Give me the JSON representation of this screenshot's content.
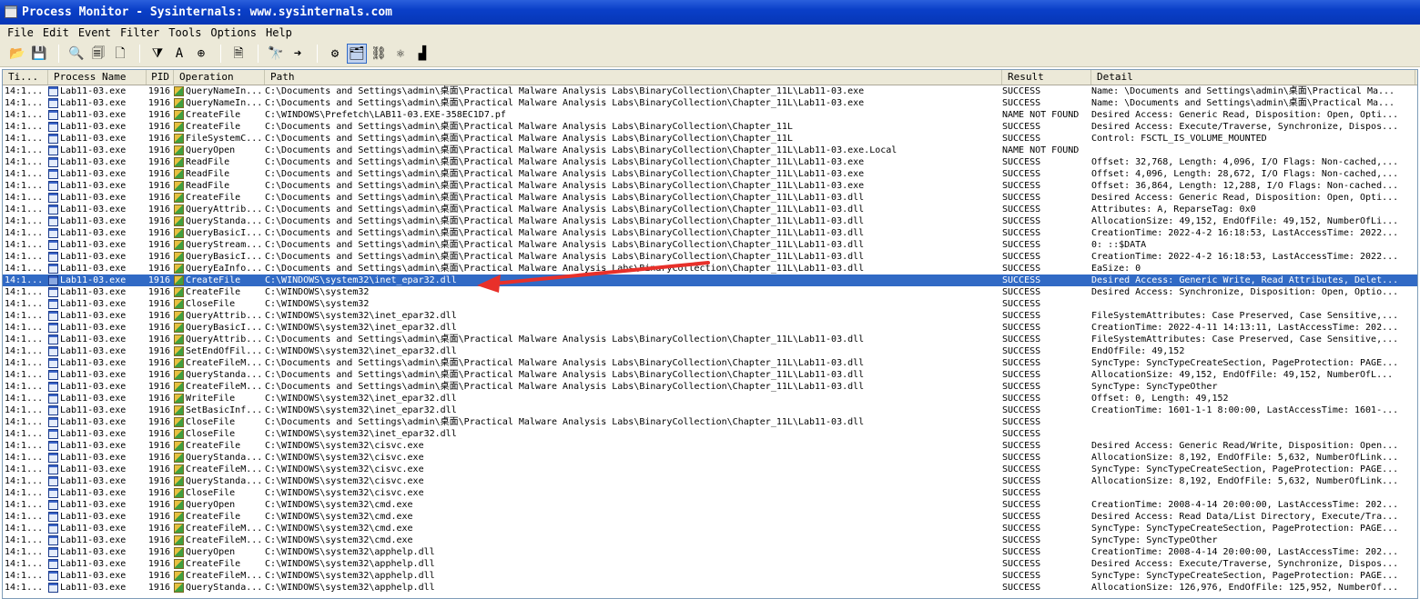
{
  "window": {
    "title": "Process Monitor - Sysinternals: www.sysinternals.com"
  },
  "menu": [
    "File",
    "Edit",
    "Event",
    "Filter",
    "Tools",
    "Options",
    "Help"
  ],
  "toolbar": {
    "buttons": [
      {
        "name": "open-icon",
        "glyph": "📂"
      },
      {
        "name": "save-icon",
        "glyph": "💾"
      },
      {
        "sep": true
      },
      {
        "name": "capture-icon",
        "glyph": "🔍"
      },
      {
        "name": "autoscroll-icon",
        "glyph": "🗐"
      },
      {
        "name": "clear-icon",
        "glyph": "🗋"
      },
      {
        "sep": true
      },
      {
        "name": "filter-icon",
        "glyph": "⧩"
      },
      {
        "name": "highlight-icon",
        "glyph": "A"
      },
      {
        "name": "include-process-icon",
        "glyph": "⊕"
      },
      {
        "sep": true
      },
      {
        "name": "process-tree-icon",
        "glyph": "🗎"
      },
      {
        "sep": true
      },
      {
        "name": "find-icon",
        "glyph": "🔭"
      },
      {
        "name": "jump-icon",
        "glyph": "➜"
      },
      {
        "sep": true
      },
      {
        "name": "registry-activity-icon",
        "glyph": "⚙"
      },
      {
        "name": "file-activity-icon",
        "glyph": "🗂",
        "active": true
      },
      {
        "name": "network-activity-icon",
        "glyph": "⛓"
      },
      {
        "name": "process-activity-icon",
        "glyph": "⚛"
      },
      {
        "name": "profiling-icon",
        "glyph": "▟"
      }
    ]
  },
  "columns": {
    "time": "Ti...",
    "process": "Process Name",
    "pid": "PID",
    "operation": "Operation",
    "path": "Path",
    "result": "Result",
    "detail": "Detail"
  },
  "colors": {
    "selection": "#316ac5",
    "arrow": "#e8302a",
    "titlebar": "#0a3fc8"
  },
  "rows": [
    {
      "t": "14:1...",
      "p": "Lab11-03.exe",
      "pid": "1916",
      "op": "QueryNameIn...",
      "path": "C:\\Documents and Settings\\admin\\桌面\\Practical Malware Analysis Labs\\BinaryCollection\\Chapter_11L\\Lab11-03.exe",
      "res": "SUCCESS",
      "det": "Name: \\Documents and Settings\\admin\\桌面\\Practical Ma..."
    },
    {
      "t": "14:1...",
      "p": "Lab11-03.exe",
      "pid": "1916",
      "op": "QueryNameIn...",
      "path": "C:\\Documents and Settings\\admin\\桌面\\Practical Malware Analysis Labs\\BinaryCollection\\Chapter_11L\\Lab11-03.exe",
      "res": "SUCCESS",
      "det": "Name: \\Documents and Settings\\admin\\桌面\\Practical Ma..."
    },
    {
      "t": "14:1...",
      "p": "Lab11-03.exe",
      "pid": "1916",
      "op": "CreateFile",
      "path": "C:\\WINDOWS\\Prefetch\\LAB11-03.EXE-358EC1D7.pf",
      "res": "NAME NOT FOUND",
      "det": "Desired Access: Generic Read, Disposition: Open, Opti..."
    },
    {
      "t": "14:1...",
      "p": "Lab11-03.exe",
      "pid": "1916",
      "op": "CreateFile",
      "path": "C:\\Documents and Settings\\admin\\桌面\\Practical Malware Analysis Labs\\BinaryCollection\\Chapter_11L",
      "res": "SUCCESS",
      "det": "Desired Access: Execute/Traverse, Synchronize, Dispos..."
    },
    {
      "t": "14:1...",
      "p": "Lab11-03.exe",
      "pid": "1916",
      "op": "FileSystemC...",
      "path": "C:\\Documents and Settings\\admin\\桌面\\Practical Malware Analysis Labs\\BinaryCollection\\Chapter_11L",
      "res": "SUCCESS",
      "det": "Control: FSCTL_IS_VOLUME_MOUNTED"
    },
    {
      "t": "14:1...",
      "p": "Lab11-03.exe",
      "pid": "1916",
      "op": "QueryOpen",
      "path": "C:\\Documents and Settings\\admin\\桌面\\Practical Malware Analysis Labs\\BinaryCollection\\Chapter_11L\\Lab11-03.exe.Local",
      "res": "NAME NOT FOUND",
      "det": ""
    },
    {
      "t": "14:1...",
      "p": "Lab11-03.exe",
      "pid": "1916",
      "op": "ReadFile",
      "path": "C:\\Documents and Settings\\admin\\桌面\\Practical Malware Analysis Labs\\BinaryCollection\\Chapter_11L\\Lab11-03.exe",
      "res": "SUCCESS",
      "det": "Offset: 32,768, Length: 4,096, I/O Flags: Non-cached,..."
    },
    {
      "t": "14:1...",
      "p": "Lab11-03.exe",
      "pid": "1916",
      "op": "ReadFile",
      "path": "C:\\Documents and Settings\\admin\\桌面\\Practical Malware Analysis Labs\\BinaryCollection\\Chapter_11L\\Lab11-03.exe",
      "res": "SUCCESS",
      "det": "Offset: 4,096, Length: 28,672, I/O Flags: Non-cached,..."
    },
    {
      "t": "14:1...",
      "p": "Lab11-03.exe",
      "pid": "1916",
      "op": "ReadFile",
      "path": "C:\\Documents and Settings\\admin\\桌面\\Practical Malware Analysis Labs\\BinaryCollection\\Chapter_11L\\Lab11-03.exe",
      "res": "SUCCESS",
      "det": "Offset: 36,864, Length: 12,288, I/O Flags: Non-cached..."
    },
    {
      "t": "14:1...",
      "p": "Lab11-03.exe",
      "pid": "1916",
      "op": "CreateFile",
      "path": "C:\\Documents and Settings\\admin\\桌面\\Practical Malware Analysis Labs\\BinaryCollection\\Chapter_11L\\Lab11-03.dll",
      "res": "SUCCESS",
      "det": "Desired Access: Generic Read, Disposition: Open, Opti..."
    },
    {
      "t": "14:1...",
      "p": "Lab11-03.exe",
      "pid": "1916",
      "op": "QueryAttrib...",
      "path": "C:\\Documents and Settings\\admin\\桌面\\Practical Malware Analysis Labs\\BinaryCollection\\Chapter_11L\\Lab11-03.dll",
      "res": "SUCCESS",
      "det": "Attributes: A, ReparseTag: 0x0"
    },
    {
      "t": "14:1...",
      "p": "Lab11-03.exe",
      "pid": "1916",
      "op": "QueryStanda...",
      "path": "C:\\Documents and Settings\\admin\\桌面\\Practical Malware Analysis Labs\\BinaryCollection\\Chapter_11L\\Lab11-03.dll",
      "res": "SUCCESS",
      "det": "AllocationSize: 49,152, EndOfFile: 49,152, NumberOfLi..."
    },
    {
      "t": "14:1...",
      "p": "Lab11-03.exe",
      "pid": "1916",
      "op": "QueryBasicI...",
      "path": "C:\\Documents and Settings\\admin\\桌面\\Practical Malware Analysis Labs\\BinaryCollection\\Chapter_11L\\Lab11-03.dll",
      "res": "SUCCESS",
      "det": "CreationTime: 2022-4-2 16:18:53, LastAccessTime: 2022..."
    },
    {
      "t": "14:1...",
      "p": "Lab11-03.exe",
      "pid": "1916",
      "op": "QueryStream...",
      "path": "C:\\Documents and Settings\\admin\\桌面\\Practical Malware Analysis Labs\\BinaryCollection\\Chapter_11L\\Lab11-03.dll",
      "res": "SUCCESS",
      "det": "0: ::$DATA"
    },
    {
      "t": "14:1...",
      "p": "Lab11-03.exe",
      "pid": "1916",
      "op": "QueryBasicI...",
      "path": "C:\\Documents and Settings\\admin\\桌面\\Practical Malware Analysis Labs\\BinaryCollection\\Chapter_11L\\Lab11-03.dll",
      "res": "SUCCESS",
      "det": "CreationTime: 2022-4-2 16:18:53, LastAccessTime: 2022..."
    },
    {
      "t": "14:1...",
      "p": "Lab11-03.exe",
      "pid": "1916",
      "op": "QueryEaInfo...",
      "path": "C:\\Documents and Settings\\admin\\桌面\\Practical Malware Analysis Labs\\BinaryCollection\\Chapter_11L\\Lab11-03.dll",
      "res": "SUCCESS",
      "det": "EaSize: 0"
    },
    {
      "t": "14:1...",
      "p": "Lab11-03.exe",
      "pid": "1916",
      "op": "CreateFile",
      "path": "C:\\WINDOWS\\system32\\inet_epar32.dll",
      "res": "SUCCESS",
      "det": "Desired Access: Generic Write, Read Attributes, Delet...",
      "selected": true
    },
    {
      "t": "14:1...",
      "p": "Lab11-03.exe",
      "pid": "1916",
      "op": "CreateFile",
      "path": "C:\\WINDOWS\\system32",
      "res": "SUCCESS",
      "det": "Desired Access: Synchronize, Disposition: Open, Optio..."
    },
    {
      "t": "14:1...",
      "p": "Lab11-03.exe",
      "pid": "1916",
      "op": "CloseFile",
      "path": "C:\\WINDOWS\\system32",
      "res": "SUCCESS",
      "det": ""
    },
    {
      "t": "14:1...",
      "p": "Lab11-03.exe",
      "pid": "1916",
      "op": "QueryAttrib...",
      "path": "C:\\WINDOWS\\system32\\inet_epar32.dll",
      "res": "SUCCESS",
      "det": "FileSystemAttributes: Case Preserved, Case Sensitive,..."
    },
    {
      "t": "14:1...",
      "p": "Lab11-03.exe",
      "pid": "1916",
      "op": "QueryBasicI...",
      "path": "C:\\WINDOWS\\system32\\inet_epar32.dll",
      "res": "SUCCESS",
      "det": "CreationTime: 2022-4-11 14:13:11, LastAccessTime: 202..."
    },
    {
      "t": "14:1...",
      "p": "Lab11-03.exe",
      "pid": "1916",
      "op": "QueryAttrib...",
      "path": "C:\\Documents and Settings\\admin\\桌面\\Practical Malware Analysis Labs\\BinaryCollection\\Chapter_11L\\Lab11-03.dll",
      "res": "SUCCESS",
      "det": "FileSystemAttributes: Case Preserved, Case Sensitive,..."
    },
    {
      "t": "14:1...",
      "p": "Lab11-03.exe",
      "pid": "1916",
      "op": "SetEndOfFil...",
      "path": "C:\\WINDOWS\\system32\\inet_epar32.dll",
      "res": "SUCCESS",
      "det": "EndOfFile: 49,152"
    },
    {
      "t": "14:1...",
      "p": "Lab11-03.exe",
      "pid": "1916",
      "op": "CreateFileM...",
      "path": "C:\\Documents and Settings\\admin\\桌面\\Practical Malware Analysis Labs\\BinaryCollection\\Chapter_11L\\Lab11-03.dll",
      "res": "SUCCESS",
      "det": "SyncType: SyncTypeCreateSection, PageProtection: PAGE..."
    },
    {
      "t": "14:1...",
      "p": "Lab11-03.exe",
      "pid": "1916",
      "op": "QueryStanda...",
      "path": "C:\\Documents and Settings\\admin\\桌面\\Practical Malware Analysis Labs\\BinaryCollection\\Chapter_11L\\Lab11-03.dll",
      "res": "SUCCESS",
      "det": "AllocationSize: 49,152, EndOfFile: 49,152, NumberOfL..."
    },
    {
      "t": "14:1...",
      "p": "Lab11-03.exe",
      "pid": "1916",
      "op": "CreateFileM...",
      "path": "C:\\Documents and Settings\\admin\\桌面\\Practical Malware Analysis Labs\\BinaryCollection\\Chapter_11L\\Lab11-03.dll",
      "res": "SUCCESS",
      "det": "SyncType: SyncTypeOther"
    },
    {
      "t": "14:1...",
      "p": "Lab11-03.exe",
      "pid": "1916",
      "op": "WriteFile",
      "path": "C:\\WINDOWS\\system32\\inet_epar32.dll",
      "res": "SUCCESS",
      "det": "Offset: 0, Length: 49,152"
    },
    {
      "t": "14:1...",
      "p": "Lab11-03.exe",
      "pid": "1916",
      "op": "SetBasicInf...",
      "path": "C:\\WINDOWS\\system32\\inet_epar32.dll",
      "res": "SUCCESS",
      "det": "CreationTime: 1601-1-1 8:00:00, LastAccessTime: 1601-..."
    },
    {
      "t": "14:1...",
      "p": "Lab11-03.exe",
      "pid": "1916",
      "op": "CloseFile",
      "path": "C:\\Documents and Settings\\admin\\桌面\\Practical Malware Analysis Labs\\BinaryCollection\\Chapter_11L\\Lab11-03.dll",
      "res": "SUCCESS",
      "det": ""
    },
    {
      "t": "14:1...",
      "p": "Lab11-03.exe",
      "pid": "1916",
      "op": "CloseFile",
      "path": "C:\\WINDOWS\\system32\\inet_epar32.dll",
      "res": "SUCCESS",
      "det": ""
    },
    {
      "t": "14:1...",
      "p": "Lab11-03.exe",
      "pid": "1916",
      "op": "CreateFile",
      "path": "C:\\WINDOWS\\system32\\cisvc.exe",
      "res": "SUCCESS",
      "det": "Desired Access: Generic Read/Write, Disposition: Open..."
    },
    {
      "t": "14:1...",
      "p": "Lab11-03.exe",
      "pid": "1916",
      "op": "QueryStanda...",
      "path": "C:\\WINDOWS\\system32\\cisvc.exe",
      "res": "SUCCESS",
      "det": "AllocationSize: 8,192, EndOfFile: 5,632, NumberOfLink..."
    },
    {
      "t": "14:1...",
      "p": "Lab11-03.exe",
      "pid": "1916",
      "op": "CreateFileM...",
      "path": "C:\\WINDOWS\\system32\\cisvc.exe",
      "res": "SUCCESS",
      "det": "SyncType: SyncTypeCreateSection, PageProtection: PAGE..."
    },
    {
      "t": "14:1...",
      "p": "Lab11-03.exe",
      "pid": "1916",
      "op": "QueryStanda...",
      "path": "C:\\WINDOWS\\system32\\cisvc.exe",
      "res": "SUCCESS",
      "det": "AllocationSize: 8,192, EndOfFile: 5,632, NumberOfLink..."
    },
    {
      "t": "14:1...",
      "p": "Lab11-03.exe",
      "pid": "1916",
      "op": "CloseFile",
      "path": "C:\\WINDOWS\\system32\\cisvc.exe",
      "res": "SUCCESS",
      "det": ""
    },
    {
      "t": "14:1...",
      "p": "Lab11-03.exe",
      "pid": "1916",
      "op": "QueryOpen",
      "path": "C:\\WINDOWS\\system32\\cmd.exe",
      "res": "SUCCESS",
      "det": "CreationTime: 2008-4-14 20:00:00, LastAccessTime: 202..."
    },
    {
      "t": "14:1...",
      "p": "Lab11-03.exe",
      "pid": "1916",
      "op": "CreateFile",
      "path": "C:\\WINDOWS\\system32\\cmd.exe",
      "res": "SUCCESS",
      "det": "Desired Access: Read Data/List Directory, Execute/Tra..."
    },
    {
      "t": "14:1...",
      "p": "Lab11-03.exe",
      "pid": "1916",
      "op": "CreateFileM...",
      "path": "C:\\WINDOWS\\system32\\cmd.exe",
      "res": "SUCCESS",
      "det": "SyncType: SyncTypeCreateSection, PageProtection: PAGE..."
    },
    {
      "t": "14:1...",
      "p": "Lab11-03.exe",
      "pid": "1916",
      "op": "CreateFileM...",
      "path": "C:\\WINDOWS\\system32\\cmd.exe",
      "res": "SUCCESS",
      "det": "SyncType: SyncTypeOther"
    },
    {
      "t": "14:1...",
      "p": "Lab11-03.exe",
      "pid": "1916",
      "op": "QueryOpen",
      "path": "C:\\WINDOWS\\system32\\apphelp.dll",
      "res": "SUCCESS",
      "det": "CreationTime: 2008-4-14 20:00:00, LastAccessTime: 202..."
    },
    {
      "t": "14:1...",
      "p": "Lab11-03.exe",
      "pid": "1916",
      "op": "CreateFile",
      "path": "C:\\WINDOWS\\system32\\apphelp.dll",
      "res": "SUCCESS",
      "det": "Desired Access: Execute/Traverse, Synchronize, Dispos..."
    },
    {
      "t": "14:1...",
      "p": "Lab11-03.exe",
      "pid": "1916",
      "op": "CreateFileM...",
      "path": "C:\\WINDOWS\\system32\\apphelp.dll",
      "res": "SUCCESS",
      "det": "SyncType: SyncTypeCreateSection, PageProtection: PAGE..."
    },
    {
      "t": "14:1...",
      "p": "Lab11-03.exe",
      "pid": "1916",
      "op": "QueryStanda...",
      "path": "C:\\WINDOWS\\system32\\apphelp.dll",
      "res": "SUCCESS",
      "det": "AllocationSize: 126,976, EndOfFile: 125,952, NumberOf..."
    }
  ]
}
